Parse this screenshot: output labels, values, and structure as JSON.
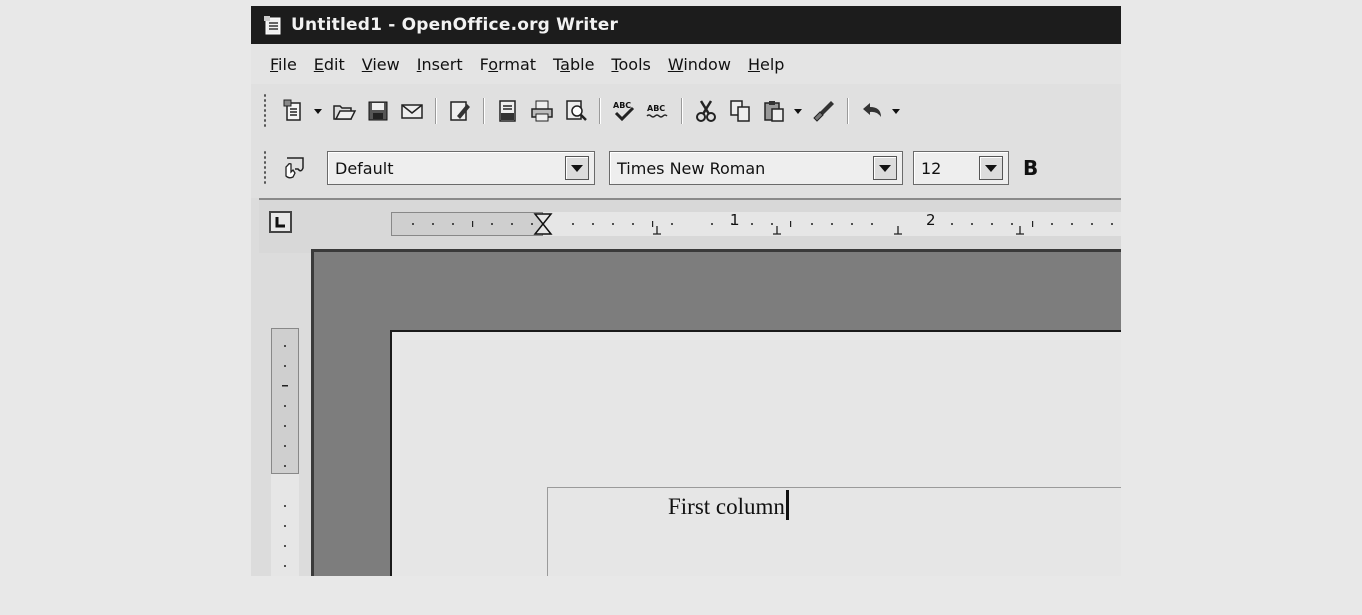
{
  "window": {
    "title": "Untitled1 - OpenOffice.org Writer",
    "app_icon": "writer-document-icon"
  },
  "menu": [
    {
      "label": "File",
      "mnemonic": "F",
      "rest": "ile"
    },
    {
      "label": "Edit",
      "mnemonic": "E",
      "rest": "dit"
    },
    {
      "label": "View",
      "mnemonic": "V",
      "rest": "iew"
    },
    {
      "label": "Insert",
      "mnemonic": "I",
      "rest": "nsert"
    },
    {
      "label": "Format",
      "pre": "F",
      "mnemonic": "o",
      "rest": "rmat"
    },
    {
      "label": "Table",
      "pre": "T",
      "mnemonic": "a",
      "rest": "ble"
    },
    {
      "label": "Tools",
      "mnemonic": "T",
      "rest": "ools"
    },
    {
      "label": "Window",
      "mnemonic": "W",
      "rest": "indow"
    },
    {
      "label": "Help",
      "mnemonic": "H",
      "rest": "elp"
    }
  ],
  "standard_toolbar": {
    "icons": [
      "new-document-icon",
      "open-folder-icon",
      "save-icon",
      "email-icon",
      "edit-file-icon",
      "export-pdf-icon",
      "print-icon",
      "page-preview-icon",
      "spellcheck-icon",
      "autospellcheck-icon",
      "cut-icon",
      "copy-icon",
      "paste-icon",
      "clone-formatting-icon",
      "undo-icon"
    ]
  },
  "formatting_toolbar": {
    "paragraph_style": "Default",
    "font_name": "Times New Roman",
    "font_size": "12",
    "bold_label": "B"
  },
  "ruler": {
    "numbers": [
      "1",
      "2"
    ]
  },
  "document": {
    "text": "First column"
  },
  "colors": {
    "titlebar": "#1c1c1c",
    "workspace": "#7d7d7d",
    "page": "#e6e6e6"
  }
}
